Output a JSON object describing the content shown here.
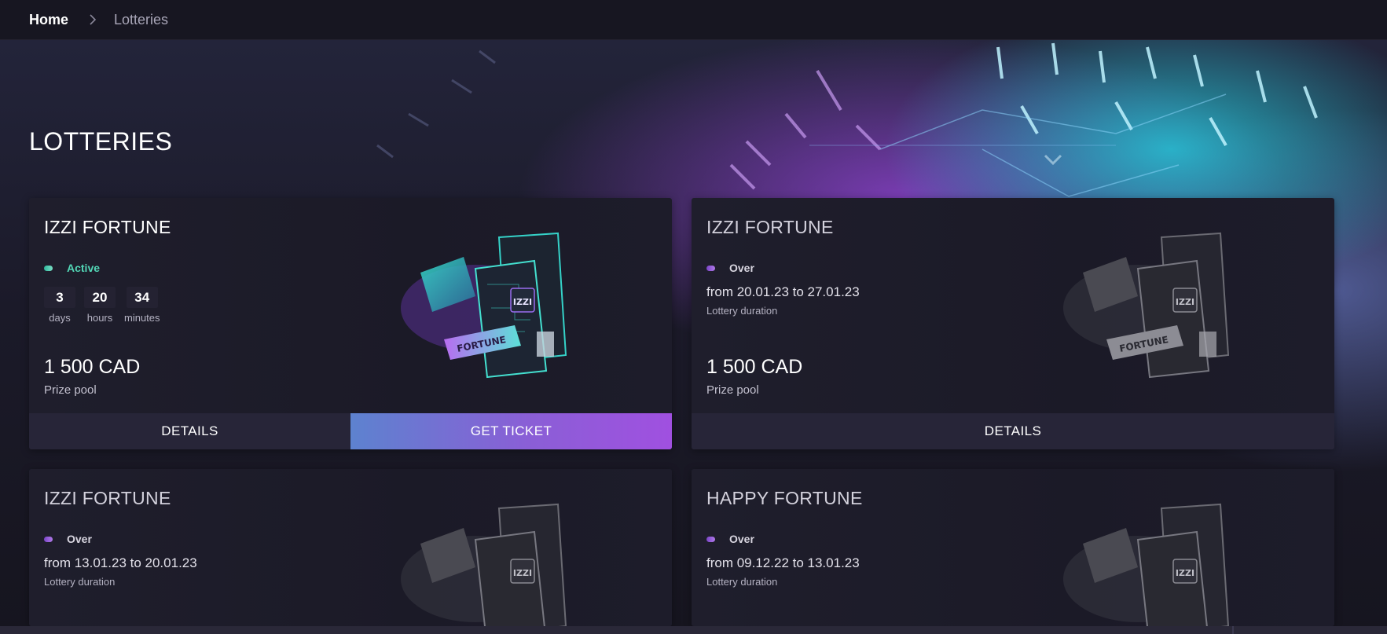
{
  "breadcrumb": {
    "home": "Home",
    "current": "Lotteries"
  },
  "page": {
    "title": "LOTTERIES"
  },
  "colors": {
    "active": "#52d6b5",
    "over": "#9b63de",
    "accent_gradient_start": "#5d82cf",
    "accent_gradient_end": "#a050e0"
  },
  "icons": {
    "separator": "chevron-right-icon",
    "ticket": "fortune-ticket-icon"
  },
  "cards": [
    {
      "title": "IZZI FORTUNE",
      "status": "Active",
      "countdown": [
        {
          "value": "3",
          "label": "days"
        },
        {
          "value": "20",
          "label": "hours"
        },
        {
          "value": "34",
          "label": "minutes"
        }
      ],
      "amount": "1 500 CAD",
      "amount_label": "Prize pool",
      "details_label": "DETAILS",
      "ticket_label": "GET TICKET"
    },
    {
      "title": "IZZI FORTUNE",
      "status": "Over",
      "dates": "from 20.01.23 to 27.01.23",
      "duration_label": "Lottery duration",
      "amount": "1 500 CAD",
      "amount_label": "Prize pool",
      "details_label": "DETAILS"
    },
    {
      "title": "IZZI FORTUNE",
      "status": "Over",
      "dates": "from 13.01.23 to 20.01.23",
      "duration_label": "Lottery duration"
    },
    {
      "title": "HAPPY FORTUNE",
      "status": "Over",
      "dates": "from 09.12.22 to 13.01.23",
      "duration_label": "Lottery duration"
    }
  ]
}
